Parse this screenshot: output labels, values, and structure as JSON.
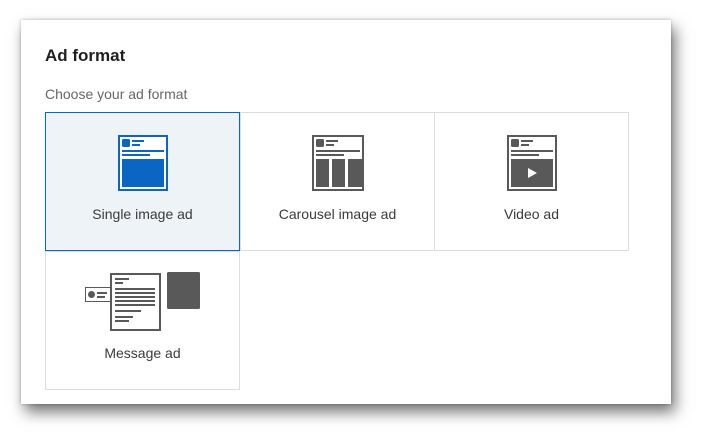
{
  "header": {
    "title": "Ad format",
    "subtitle": "Choose your ad format"
  },
  "formats": [
    {
      "label": "Single image ad",
      "selected": true,
      "icon": "single-image-icon"
    },
    {
      "label": "Carousel image ad",
      "selected": false,
      "icon": "carousel-image-icon"
    },
    {
      "label": "Video ad",
      "selected": false,
      "icon": "video-icon"
    },
    {
      "label": "Message ad",
      "selected": false,
      "icon": "message-icon"
    }
  ],
  "colors": {
    "accent": "#0a66c2",
    "selected_bg": "#eef3f8",
    "icon_gray": "#595959"
  }
}
